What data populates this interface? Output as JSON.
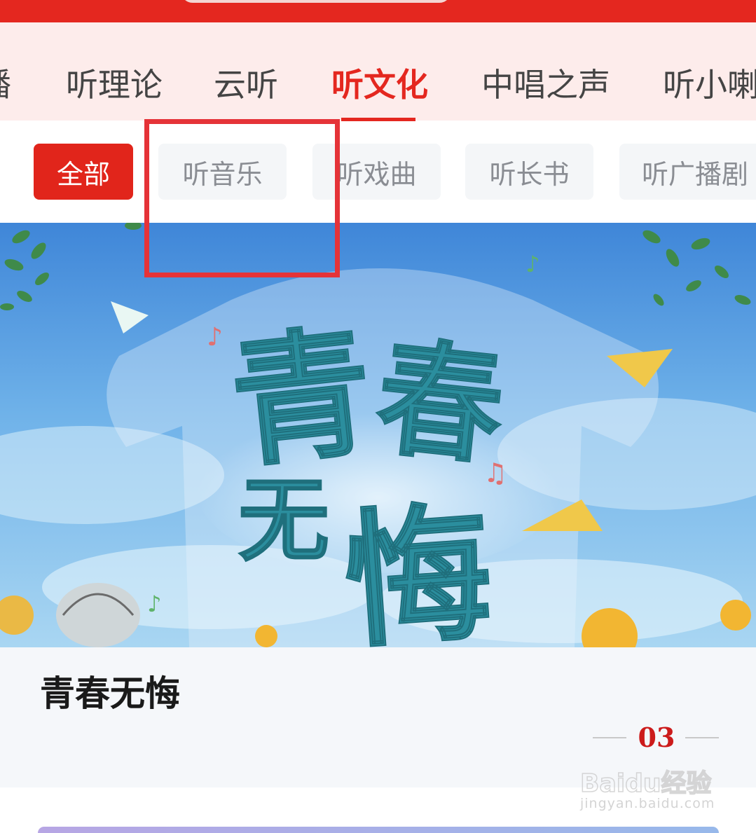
{
  "main_tabs": [
    {
      "label": "播"
    },
    {
      "label": "听理论"
    },
    {
      "label": "云听"
    },
    {
      "label": "听文化"
    },
    {
      "label": "中唱之声"
    },
    {
      "label": "听小喇"
    }
  ],
  "sub_tabs": [
    {
      "label": "全部"
    },
    {
      "label": "听音乐"
    },
    {
      "label": "听戏曲"
    },
    {
      "label": "听长书"
    },
    {
      "label": "听广播剧"
    }
  ],
  "banner": {
    "calligraphy": [
      "青",
      "春",
      "无",
      "悔"
    ]
  },
  "card": {
    "title": "青春无悔",
    "page_number": "03"
  },
  "watermark": {
    "brand": "Baidu经验",
    "url": "jingyan.baidu.com"
  },
  "colors": {
    "accent": "#e4271f",
    "highlight": "#e53338",
    "tab_bg": "#fdeceb"
  }
}
